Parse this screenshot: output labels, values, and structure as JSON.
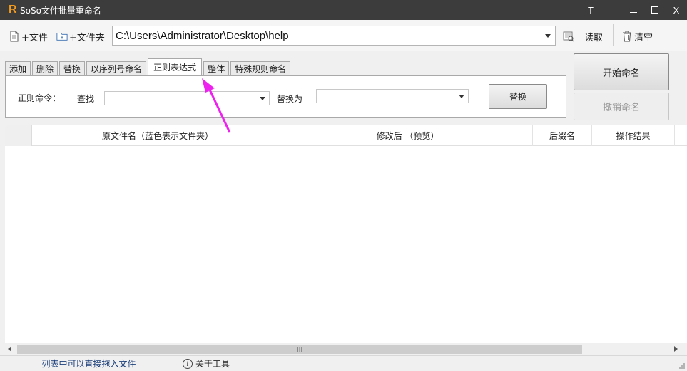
{
  "window": {
    "logo": "R",
    "title": "SoSo文件批量重命名",
    "controls": [
      "T",
      "–",
      "—",
      "☐",
      "X"
    ],
    "icons": [
      "pin-icon",
      "minimize-dash-icon",
      "minimize-icon",
      "maximize-icon",
      "close-icon"
    ]
  },
  "toolbar": {
    "add_file": "+文件",
    "add_folder": "+文件夹",
    "path_value": "C:\\Users\\Administrator\\Desktop\\help",
    "read": "读取",
    "clear": "清空"
  },
  "tabs": [
    {
      "label": "添加",
      "active": false
    },
    {
      "label": "删除",
      "active": false
    },
    {
      "label": "替换",
      "active": false
    },
    {
      "label": "以序列号命名",
      "active": false
    },
    {
      "label": "正则表达式",
      "active": true
    },
    {
      "label": "整体",
      "active": false
    },
    {
      "label": "特殊规则命名",
      "active": false
    }
  ],
  "regex_panel": {
    "command_label": "正则命令：",
    "find_label": "查找",
    "find_value": "",
    "replace_with_label": "替换为",
    "replace_value": "",
    "replace_button": "替换"
  },
  "actions": {
    "start_rename": "开始命名",
    "undo_rename": "撤销命名"
  },
  "table": {
    "columns": [
      "原文件名（蓝色表示文件夹）",
      "修改后 （预览）",
      "后缀名",
      "操作结果"
    ],
    "rows": []
  },
  "status_bar": {
    "hint": "列表中可以直接拖入文件",
    "about": "关于工具"
  },
  "colors": {
    "titlebar": "#3c3c3c",
    "logo": "#f29a1f",
    "annotation_arrow": "#ee22ee",
    "status_hint": "#1b3f7a"
  }
}
